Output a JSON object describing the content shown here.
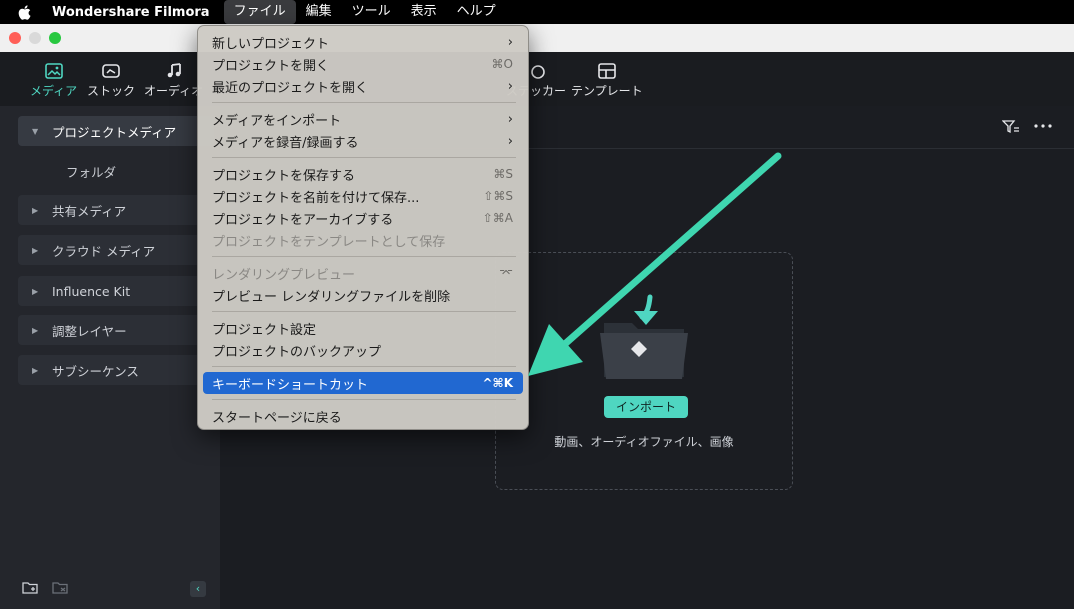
{
  "menubar": {
    "app_name": "Wondershare Filmora",
    "items": [
      "ファイル",
      "編集",
      "ツール",
      "表示",
      "ヘルプ"
    ]
  },
  "toolbar": {
    "items": [
      {
        "label": "メディア",
        "icon": "media-icon"
      },
      {
        "label": "ストック",
        "icon": "stock-icon"
      },
      {
        "label": "オーディオ",
        "icon": "audio-icon"
      },
      {
        "label": "ステッカー",
        "icon": "sticker-icon"
      },
      {
        "label": "テンプレート",
        "icon": "template-icon"
      }
    ]
  },
  "sidebar": {
    "items": [
      {
        "label": "プロジェクトメディア"
      },
      {
        "label": "フォルダ"
      },
      {
        "label": "共有メディア"
      },
      {
        "label": "クラウド メディア"
      },
      {
        "label": "Influence Kit"
      },
      {
        "label": "調整レイヤー"
      },
      {
        "label": "サブシーケンス"
      }
    ]
  },
  "dropzone": {
    "button_label": "インポート",
    "hint": "動画、オーディオファイル、画像"
  },
  "file_menu": {
    "items": [
      {
        "label": "新しいプロジェクト",
        "shortcut": "",
        "submenu": true
      },
      {
        "label": "プロジェクトを開く",
        "shortcut": "⌘O"
      },
      {
        "label": "最近のプロジェクトを開く",
        "shortcut": "",
        "submenu": true
      },
      {
        "label": "メディアをインポート",
        "shortcut": "",
        "submenu": true
      },
      {
        "label": "メディアを録音/録画する",
        "shortcut": "",
        "submenu": true
      },
      {
        "label": "プロジェクトを保存する",
        "shortcut": "⌘S"
      },
      {
        "label": "プロジェクトを名前を付けて保存...",
        "shortcut": "⇧⌘S"
      },
      {
        "label": "プロジェクトをアーカイブする",
        "shortcut": "⇧⌘A"
      },
      {
        "label": "プロジェクトをテンプレートとして保存",
        "shortcut": "",
        "disabled": true
      },
      {
        "label": "レンダリングプレビュー",
        "shortcut": "⌤",
        "disabled": true
      },
      {
        "label": "プレビュー レンダリングファイルを削除",
        "shortcut": ""
      },
      {
        "label": "プロジェクト設定",
        "shortcut": ""
      },
      {
        "label": "プロジェクトのバックアップ",
        "shortcut": ""
      },
      {
        "label": "キーボードショートカット",
        "shortcut": "^⌘K",
        "highlighted": true
      },
      {
        "label": "スタートページに戻る",
        "shortcut": ""
      }
    ]
  },
  "colors": {
    "accent": "#4fd6c1",
    "highlight": "#2168d1",
    "arrow": "#3fd6b0"
  }
}
